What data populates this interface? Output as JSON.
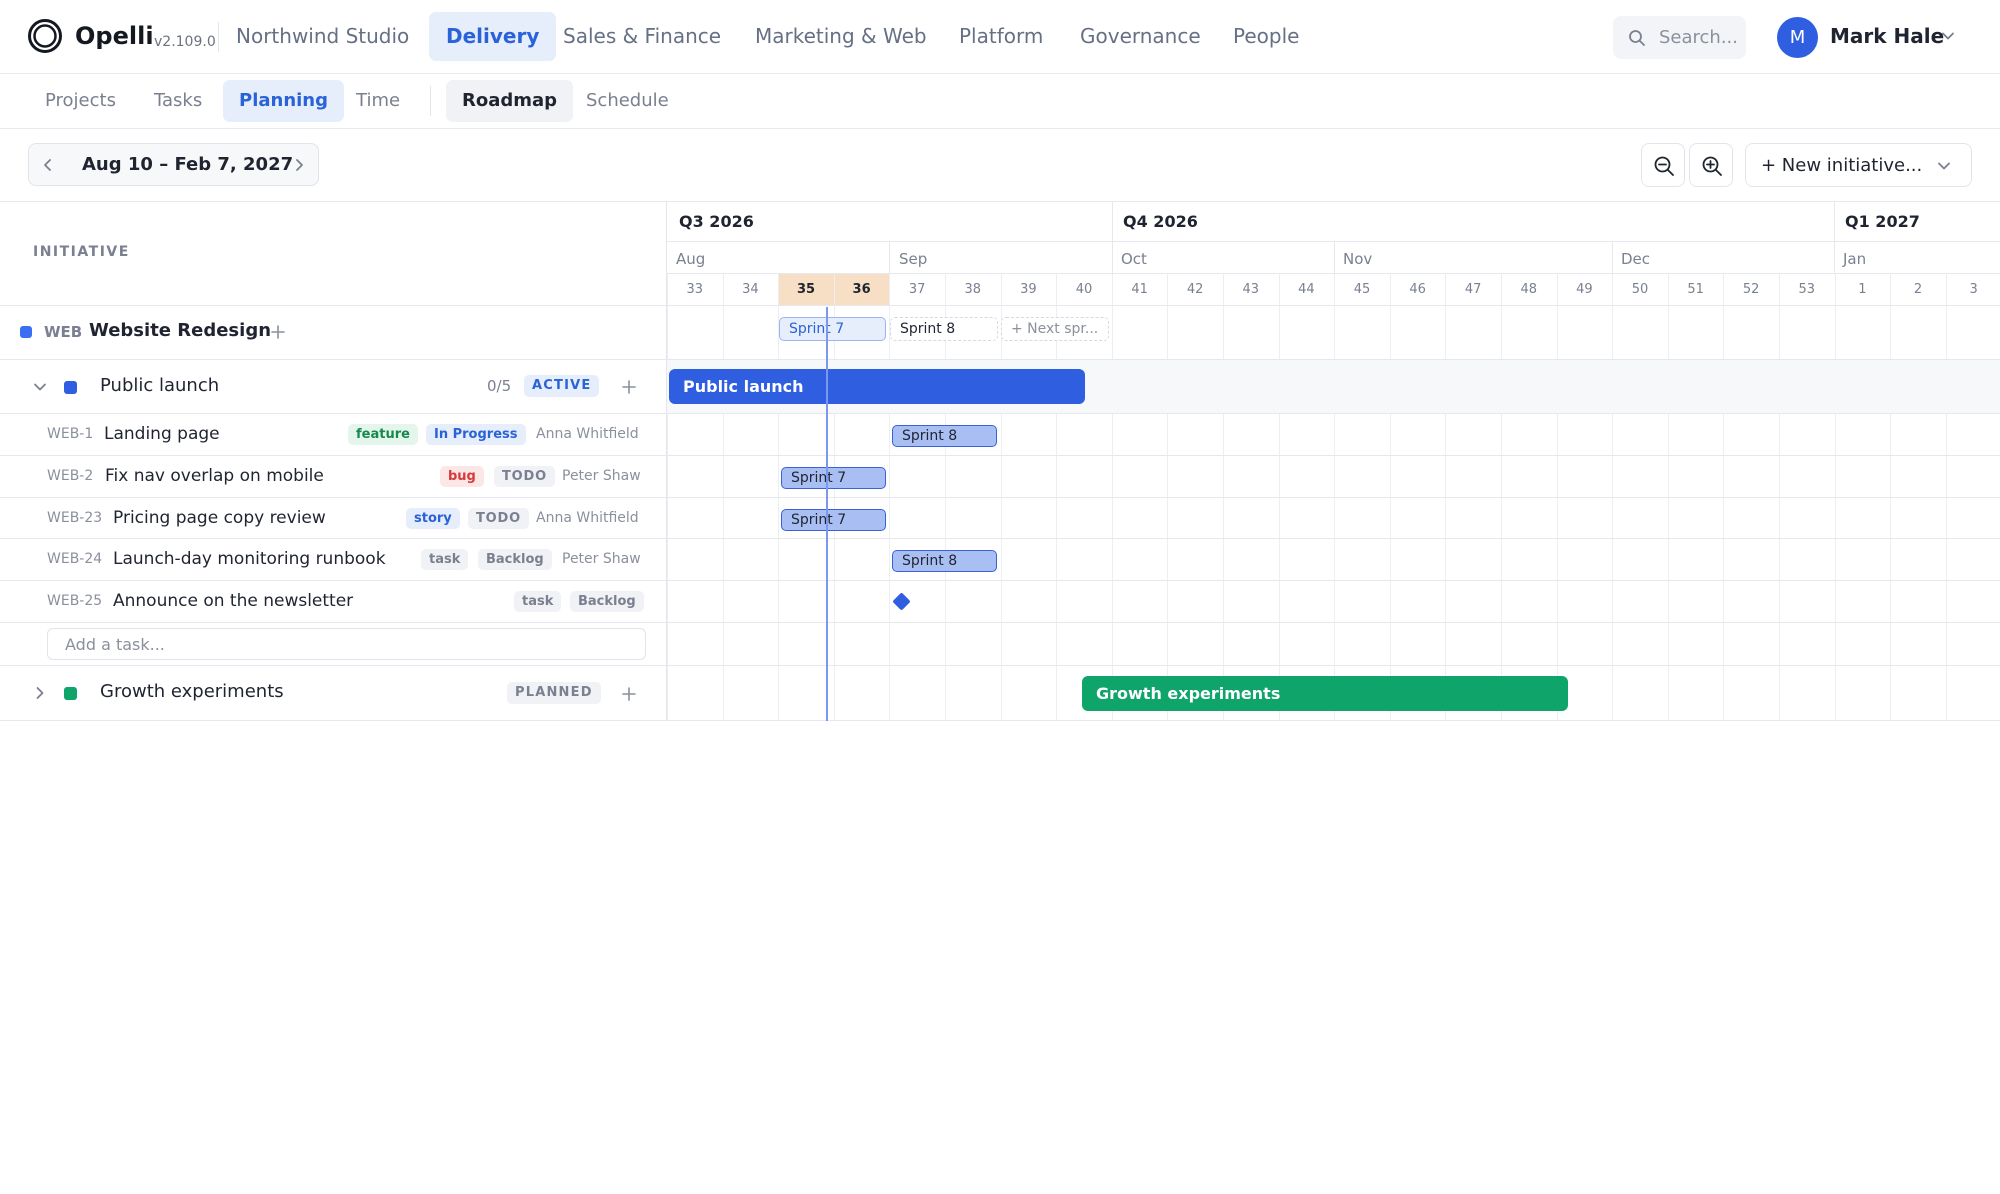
{
  "app": {
    "brand": "Opelli",
    "version": "v2.109.0"
  },
  "topnav": [
    {
      "label": "Northwind Studio"
    },
    {
      "label": "Delivery"
    },
    {
      "label": "Sales & Finance"
    },
    {
      "label": "Marketing & Web"
    },
    {
      "label": "Platform"
    },
    {
      "label": "Governance"
    },
    {
      "label": "People"
    }
  ],
  "search": {
    "placeholder": "Search..."
  },
  "user": {
    "initial": "M",
    "name": "Mark Hale"
  },
  "subnav": [
    {
      "label": "Projects"
    },
    {
      "label": "Tasks"
    },
    {
      "label": "Planning"
    },
    {
      "label": "Time"
    },
    {
      "label": "Roadmap"
    },
    {
      "label": "Schedule"
    }
  ],
  "toolbar": {
    "date_range": "Aug 10 – Feb 7, 2027",
    "new_initiative": "+ New initiative..."
  },
  "grid": {
    "initiative_header": "INITIATIVE",
    "quarters": [
      "Q3 2026",
      "Q4 2026",
      "Q1 2027"
    ],
    "months": [
      "Aug",
      "Sep",
      "Oct",
      "Nov",
      "Dec",
      "Jan"
    ],
    "weeks": [
      "33",
      "34",
      "35",
      "36",
      "37",
      "38",
      "39",
      "40",
      "41",
      "42",
      "43",
      "44",
      "45",
      "46",
      "47",
      "48",
      "49",
      "50",
      "51",
      "52",
      "53",
      "1",
      "2",
      "3"
    ],
    "highlighted_weeks": [
      "35",
      "36"
    ]
  },
  "project": {
    "key": "WEB",
    "name": "Website Redesign",
    "color": "#3a6ff2",
    "sprints": [
      {
        "label": "Sprint 7"
      },
      {
        "label": "Sprint 8"
      },
      {
        "label": "+ Next spr..."
      }
    ]
  },
  "initiatives": [
    {
      "name": "Public launch",
      "count": "0/5",
      "status": "ACTIVE",
      "color": "#2f5fe0",
      "bar_label": "Public launch",
      "tasks": [
        {
          "key": "WEB-1",
          "name": "Landing page",
          "tag": "feature",
          "status": "In Progress",
          "assignee": "Anna Whitfield",
          "sprint": "Sprint 8"
        },
        {
          "key": "WEB-2",
          "name": "Fix nav overlap on mobile",
          "tag": "bug",
          "status": "TODO",
          "assignee": "Peter Shaw",
          "sprint": "Sprint 7"
        },
        {
          "key": "WEB-23",
          "name": "Pricing page copy review",
          "tag": "story",
          "status": "TODO",
          "assignee": "Anna Whitfield",
          "sprint": "Sprint 7"
        },
        {
          "key": "WEB-24",
          "name": "Launch-day monitoring runbook",
          "tag": "task",
          "status": "Backlog",
          "assignee": "Peter Shaw",
          "sprint": "Sprint 8"
        },
        {
          "key": "WEB-25",
          "name": "Announce on the newsletter",
          "tag": "task",
          "status": "Backlog",
          "assignee": "",
          "sprint": ""
        }
      ],
      "add_task_placeholder": "Add a task..."
    },
    {
      "name": "Growth experiments",
      "status": "PLANNED",
      "color": "#0fa56a",
      "bar_label": "Growth experiments"
    }
  ]
}
